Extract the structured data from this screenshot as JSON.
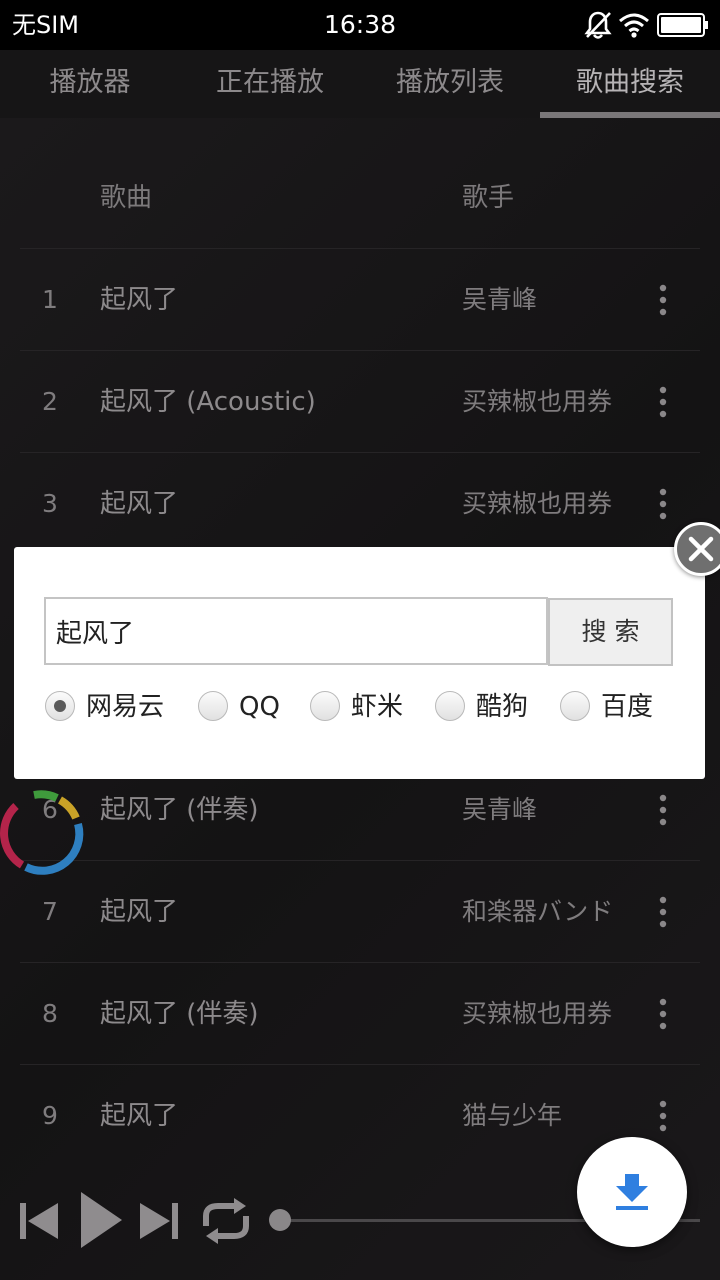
{
  "status_bar": {
    "carrier": "无SIM",
    "time": "16:38",
    "icons": [
      "bell-off-icon",
      "wifi-icon",
      "battery-icon"
    ]
  },
  "tabs": [
    {
      "label": "播放器",
      "active": false
    },
    {
      "label": "正在播放",
      "active": false
    },
    {
      "label": "播放列表",
      "active": false
    },
    {
      "label": "歌曲搜索",
      "active": true
    }
  ],
  "list_header": {
    "title": "歌曲",
    "artist": "歌手"
  },
  "songs": [
    {
      "index": "1",
      "title": "起风了",
      "artist": "吴青峰"
    },
    {
      "index": "2",
      "title": "起风了 (Acoustic)",
      "artist": "买辣椒也用券"
    },
    {
      "index": "3",
      "title": "起风了",
      "artist": "买辣椒也用券"
    },
    {
      "index": "6",
      "title": "起风了 (伴奏)",
      "artist": "吴青峰"
    },
    {
      "index": "7",
      "title": "起风了",
      "artist": "和楽器バンド"
    },
    {
      "index": "8",
      "title": "起风了 (伴奏)",
      "artist": "买辣椒也用券"
    },
    {
      "index": "9",
      "title": "起风了",
      "artist": "猫与少年"
    }
  ],
  "search_dialog": {
    "query": "起风了",
    "button_label": "搜索",
    "sources": [
      {
        "label": "网易云",
        "selected": true
      },
      {
        "label": "QQ",
        "selected": false
      },
      {
        "label": "虾米",
        "selected": false
      },
      {
        "label": "酷狗",
        "selected": false
      },
      {
        "label": "百度",
        "selected": false
      }
    ]
  },
  "player": {
    "progress": 0
  },
  "colors": {
    "background": "#171617",
    "dialog": "#ffffff",
    "download_accent": "#2f7fe0"
  }
}
